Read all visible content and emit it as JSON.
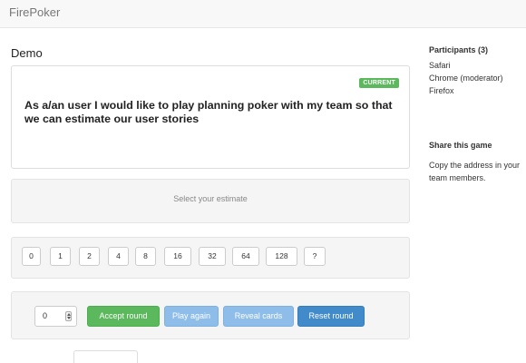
{
  "app": {
    "brand": "FirePoker"
  },
  "game": {
    "title": "Demo",
    "story": {
      "badge": "CURRENT",
      "text": "As a/an user I would like to play planning poker with my team so that we can estimate our user stories"
    },
    "estimate_prompt": "Select your estimate",
    "cards": [
      "0",
      "1",
      "2",
      "4",
      "8",
      "16",
      "32",
      "64",
      "128",
      "?"
    ],
    "controls": {
      "estimate_value": "0",
      "accept_label": "Accept round",
      "play_again_label": "Play again",
      "reveal_label": "Reveal cards",
      "reset_label": "Reset round"
    }
  },
  "sidebar": {
    "participants_heading": "Participants (3)",
    "participants": [
      "Safari",
      "Chrome (moderator)",
      "Firefox"
    ],
    "share_heading": "Share this game",
    "share_text": "Copy the address in your team members."
  },
  "colors": {
    "accept": "#5cb85c",
    "play_again": "#8dbde8",
    "reveal": "#8dbde8",
    "reset": "#428bca",
    "badge": "#5cb85c"
  },
  "icons": {
    "spinner": "number-spinner-icon"
  }
}
